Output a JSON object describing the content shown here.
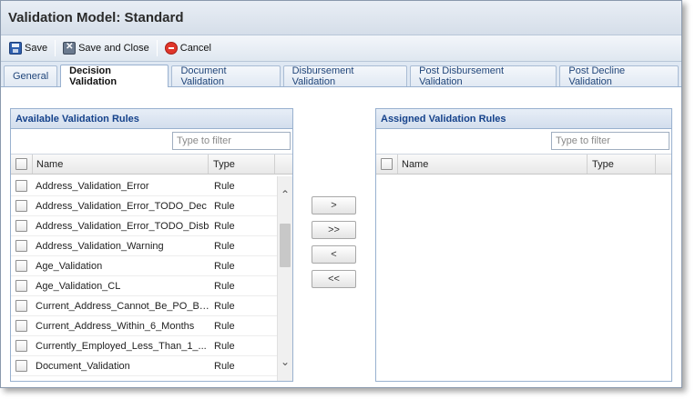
{
  "title": "Validation Model: Standard",
  "toolbar": {
    "save": "Save",
    "save_close": "Save and Close",
    "cancel": "Cancel"
  },
  "tabs": [
    {
      "label": "General",
      "active": false
    },
    {
      "label": "Decision Validation",
      "active": true
    },
    {
      "label": "Document Validation",
      "active": false
    },
    {
      "label": "Disbursement Validation",
      "active": false
    },
    {
      "label": "Post Disbursement Validation",
      "active": false
    },
    {
      "label": "Post Decline Validation",
      "active": false
    }
  ],
  "available": {
    "title": "Available Validation Rules",
    "filter_placeholder": "Type to filter",
    "col_name": "Name",
    "col_type": "Type",
    "rows": [
      {
        "name": "Address_Validation_Error",
        "type": "Rule"
      },
      {
        "name": "Address_Validation_Error_TODO_Dec",
        "type": "Rule"
      },
      {
        "name": "Address_Validation_Error_TODO_Disb",
        "type": "Rule"
      },
      {
        "name": "Address_Validation_Warning",
        "type": "Rule"
      },
      {
        "name": "Age_Validation",
        "type": "Rule"
      },
      {
        "name": "Age_Validation_CL",
        "type": "Rule"
      },
      {
        "name": "Current_Address_Cannot_Be_PO_Box",
        "type": "Rule"
      },
      {
        "name": "Current_Address_Within_6_Months",
        "type": "Rule"
      },
      {
        "name": "Currently_Employed_Less_Than_1_...",
        "type": "Rule"
      },
      {
        "name": "Document_Validation",
        "type": "Rule"
      }
    ]
  },
  "assigned": {
    "title": "Assigned Validation Rules",
    "filter_placeholder": "Type to filter",
    "col_name": "Name",
    "col_type": "Type"
  },
  "move_buttons": {
    "add": ">",
    "add_all": ">>",
    "remove": "<",
    "remove_all": "<<"
  },
  "colors": {
    "header_text": "#15428b",
    "border": "#99b1cf",
    "toolbar_bg": "#dfe7f0"
  },
  "icons": {
    "save": "save-icon",
    "save_close": "save-close-icon",
    "cancel": "cancel-icon"
  }
}
